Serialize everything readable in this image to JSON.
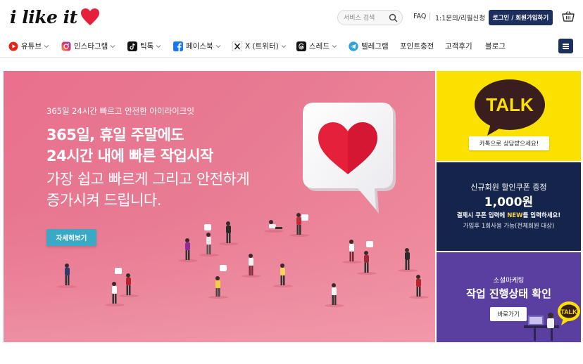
{
  "header": {
    "logo_text": "i like it",
    "search_placeholder": "서비스 검색",
    "links": [
      "FAQ",
      "1:1문의/리필신청"
    ],
    "login_label": "로그인 / 회원가입하기"
  },
  "nav": {
    "items": [
      {
        "label": "유튜브",
        "icon": "youtube-icon",
        "dropdown": true
      },
      {
        "label": "인스타그램",
        "icon": "instagram-icon",
        "dropdown": true
      },
      {
        "label": "틱톡",
        "icon": "tiktok-icon",
        "dropdown": true
      },
      {
        "label": "페이스북",
        "icon": "facebook-icon",
        "dropdown": true
      },
      {
        "label": "X (트위터)",
        "icon": "x-icon",
        "dropdown": true
      },
      {
        "label": "스레드",
        "icon": "threads-icon",
        "dropdown": true
      },
      {
        "label": "텔레그램",
        "icon": "telegram-icon",
        "dropdown": false
      },
      {
        "label": "포인트충전",
        "icon": "",
        "dropdown": false
      },
      {
        "label": "고객후기",
        "icon": "",
        "dropdown": false
      },
      {
        "label": "블로그",
        "icon": "",
        "dropdown": false
      }
    ]
  },
  "hero": {
    "eyebrow": "365일 24시간 빠르고 안전한 아이라이크잇",
    "title_line1": "365일, 휴일 주말에도",
    "title_line2": "24시간 내에 빠른 작업시작",
    "sub_line1": "가장 쉽고 빠르게 그리고 안전하게",
    "sub_line2": "증가시켜 드립니다.",
    "button_label": "자세히보기"
  },
  "side": {
    "kakao": {
      "talk_text": "TALK",
      "button_label": "카톡으로 상담받으세요!"
    },
    "coupon": {
      "line1": "신규회원 할인쿠폰 증정",
      "amount": "1,000원",
      "line3_pre": "결제시 쿠폰 입력에 ",
      "line3_highlight": "NEW",
      "line3_post": "를 입력하세요!",
      "line4": "가입후 1회사용 가능(전체회원 대상)"
    },
    "marketing": {
      "small": "소셜마케팅",
      "title": "작업 진행상태 확인",
      "button_label": "바로가기",
      "badge_text": "TALK"
    }
  },
  "colors": {
    "navy": "#1d2f5e",
    "hero_pink": "#e9708e",
    "kakao_yellow": "#fae100",
    "coupon_navy": "#14244a",
    "marketing_purple": "#5a3fa0",
    "cta_teal": "#3aa9c6",
    "heart_red": "#e5203a"
  }
}
